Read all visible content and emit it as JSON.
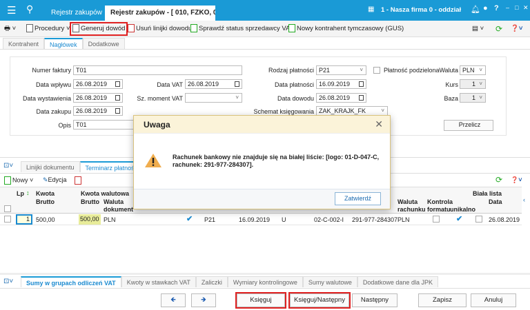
{
  "topbar": {
    "tabs": [
      "Rejestr zakupów",
      "Rejestr zakupów - [ 010, FZKO, 0 ] -"
    ],
    "company": "1 - Nasza firma 0 - oddział"
  },
  "toolbar": {
    "procedures": "Procedury",
    "generate": "Generuj dowód",
    "remove_lines": "Usuń linijki dowodu",
    "check_vat": "Sprawdź status sprzedawcy VAT",
    "new_contractor": "Nowy kontrahent tymczasowy (GUS)"
  },
  "main_tabs": [
    "Kontrahent",
    "Nagłówek",
    "Dodatkowe"
  ],
  "form": {
    "invoice_no": {
      "label": "Numer faktury",
      "value": "T01"
    },
    "receipt_date": {
      "label": "Data wpływu",
      "value": "26.08.2019"
    },
    "issue_date": {
      "label": "Data wystawienia",
      "value": "26.08.2019"
    },
    "purchase_date": {
      "label": "Data zakupu",
      "value": "26.08.2019"
    },
    "description": {
      "label": "Opis",
      "value": "T01"
    },
    "vat_date": {
      "label": "Data VAT",
      "value": "26.08.2019"
    },
    "vat_moment": {
      "label": "Sz. moment VAT",
      "value": ""
    },
    "payment_type": {
      "label": "Rodzaj płatności",
      "value": "P21"
    },
    "split_payment": {
      "label": "Płatność podzielona",
      "checked": false
    },
    "payment_date": {
      "label": "Data płatności",
      "value": "16.09.2019"
    },
    "doc_date": {
      "label": "Data dowodu",
      "value": "26.08.2019"
    },
    "scheme": {
      "label": "Schemat księgowania",
      "value": "ZAK_KRAJK_FK"
    },
    "currency": {
      "label": "Waluta",
      "value": "PLN"
    },
    "rate": {
      "label": "Kurs",
      "value": "1"
    },
    "base": {
      "label": "Baza",
      "value": "1"
    },
    "recalc": "Przelicz"
  },
  "lower_tabs": [
    "Linijki dokumentu",
    "Terminarz płatności"
  ],
  "lower_toolbar": {
    "new": "Nowy",
    "edit": "Edycja"
  },
  "table": {
    "headers": {
      "lp": "Lp",
      "amount": "Kwota",
      "gross": "Brutto",
      "fx_amount": "Kwota walutowa",
      "fx_gross": "Brutto",
      "doc_currency1": "Waluta",
      "doc_currency2": "dokument",
      "acct_currency1": "Waluta",
      "acct_currency2": "rachunku",
      "control": "Kontrola",
      "format": "formatu",
      "unique": "unikalno",
      "whitelist": "Biała lista",
      "date": "Data"
    },
    "rows": [
      {
        "lp": "1",
        "gross": "500,00",
        "fx_gross": "500,00",
        "currency": "PLN",
        "checked1": true,
        "payment": "P21",
        "due": "16.09.2019",
        "type": "U",
        "logo": "02-C-002-I",
        "account": "291-977-284307",
        "acct_currency": "PLN",
        "format": false,
        "unique": true,
        "whitelist": false,
        "date": "26.08.2019"
      }
    ]
  },
  "dialog": {
    "title": "Uwaga",
    "message": "Rachunek bankowy nie znajduje się na białej liście: [logo: 01-D-047-C, rachunek: 291-977-284307].",
    "confirm": "Zatwierdź"
  },
  "bottom_tabs": [
    "Sumy w grupach odliczeń VAT",
    "Kwoty w stawkach VAT",
    "Zaliczki",
    "Wymiary kontrolingowe",
    "Sumy walutowe",
    "Dodatkowe dane dla JPK"
  ],
  "buttons": {
    "post": "Księguj",
    "post_next": "Księguj/Następny",
    "next": "Następny",
    "save": "Zapisz",
    "cancel": "Anuluj"
  },
  "colors": {
    "accent": "#1a9ad6",
    "highlight": "#e02020"
  }
}
